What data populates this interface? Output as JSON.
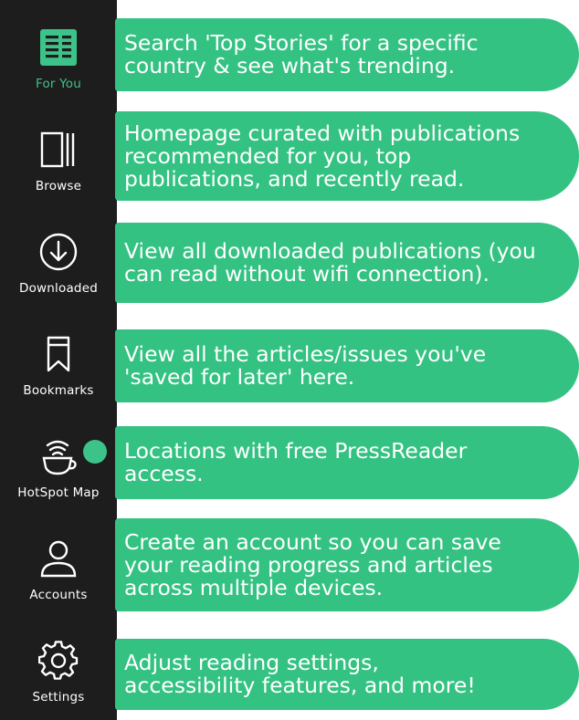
{
  "sidebar": {
    "items": [
      {
        "label": "For You",
        "icon": "newspaper-icon",
        "active": true
      },
      {
        "label": "Browse",
        "icon": "library-icon",
        "active": false
      },
      {
        "label": "Downloaded",
        "icon": "download-icon",
        "active": false
      },
      {
        "label": "Bookmarks",
        "icon": "bookmark-icon",
        "active": false
      },
      {
        "label": "HotSpot Map",
        "icon": "coffee-cup-wifi-icon",
        "active": false
      },
      {
        "label": "Accounts",
        "icon": "user-icon",
        "active": false
      },
      {
        "label": "Settings",
        "icon": "gear-icon",
        "active": false
      }
    ]
  },
  "callouts": [
    {
      "lines": [
        "Search 'Top Stories' for a specific",
        "country & see what's trending."
      ]
    },
    {
      "lines": [
        "Homepage curated with publications",
        "recommended for you, top",
        "publications, and recently read."
      ]
    },
    {
      "lines": [
        "View all downloaded publications (you",
        "can read without wifi connection)."
      ]
    },
    {
      "lines": [
        "View all the articles/issues you've",
        "'saved for later' here."
      ]
    },
    {
      "lines": [
        "Locations with free PressReader",
        "access."
      ]
    },
    {
      "lines": [
        "Create an account so you can save",
        "your reading progress and articles",
        "across multiple devices."
      ]
    },
    {
      "lines": [
        "Adjust reading settings,",
        "accessibility features, and more!"
      ]
    }
  ],
  "colors": {
    "sidebar_bg": "#1d1d1d",
    "accent": "#34c283",
    "active_label": "#3cc38a",
    "text": "#ffffff"
  }
}
